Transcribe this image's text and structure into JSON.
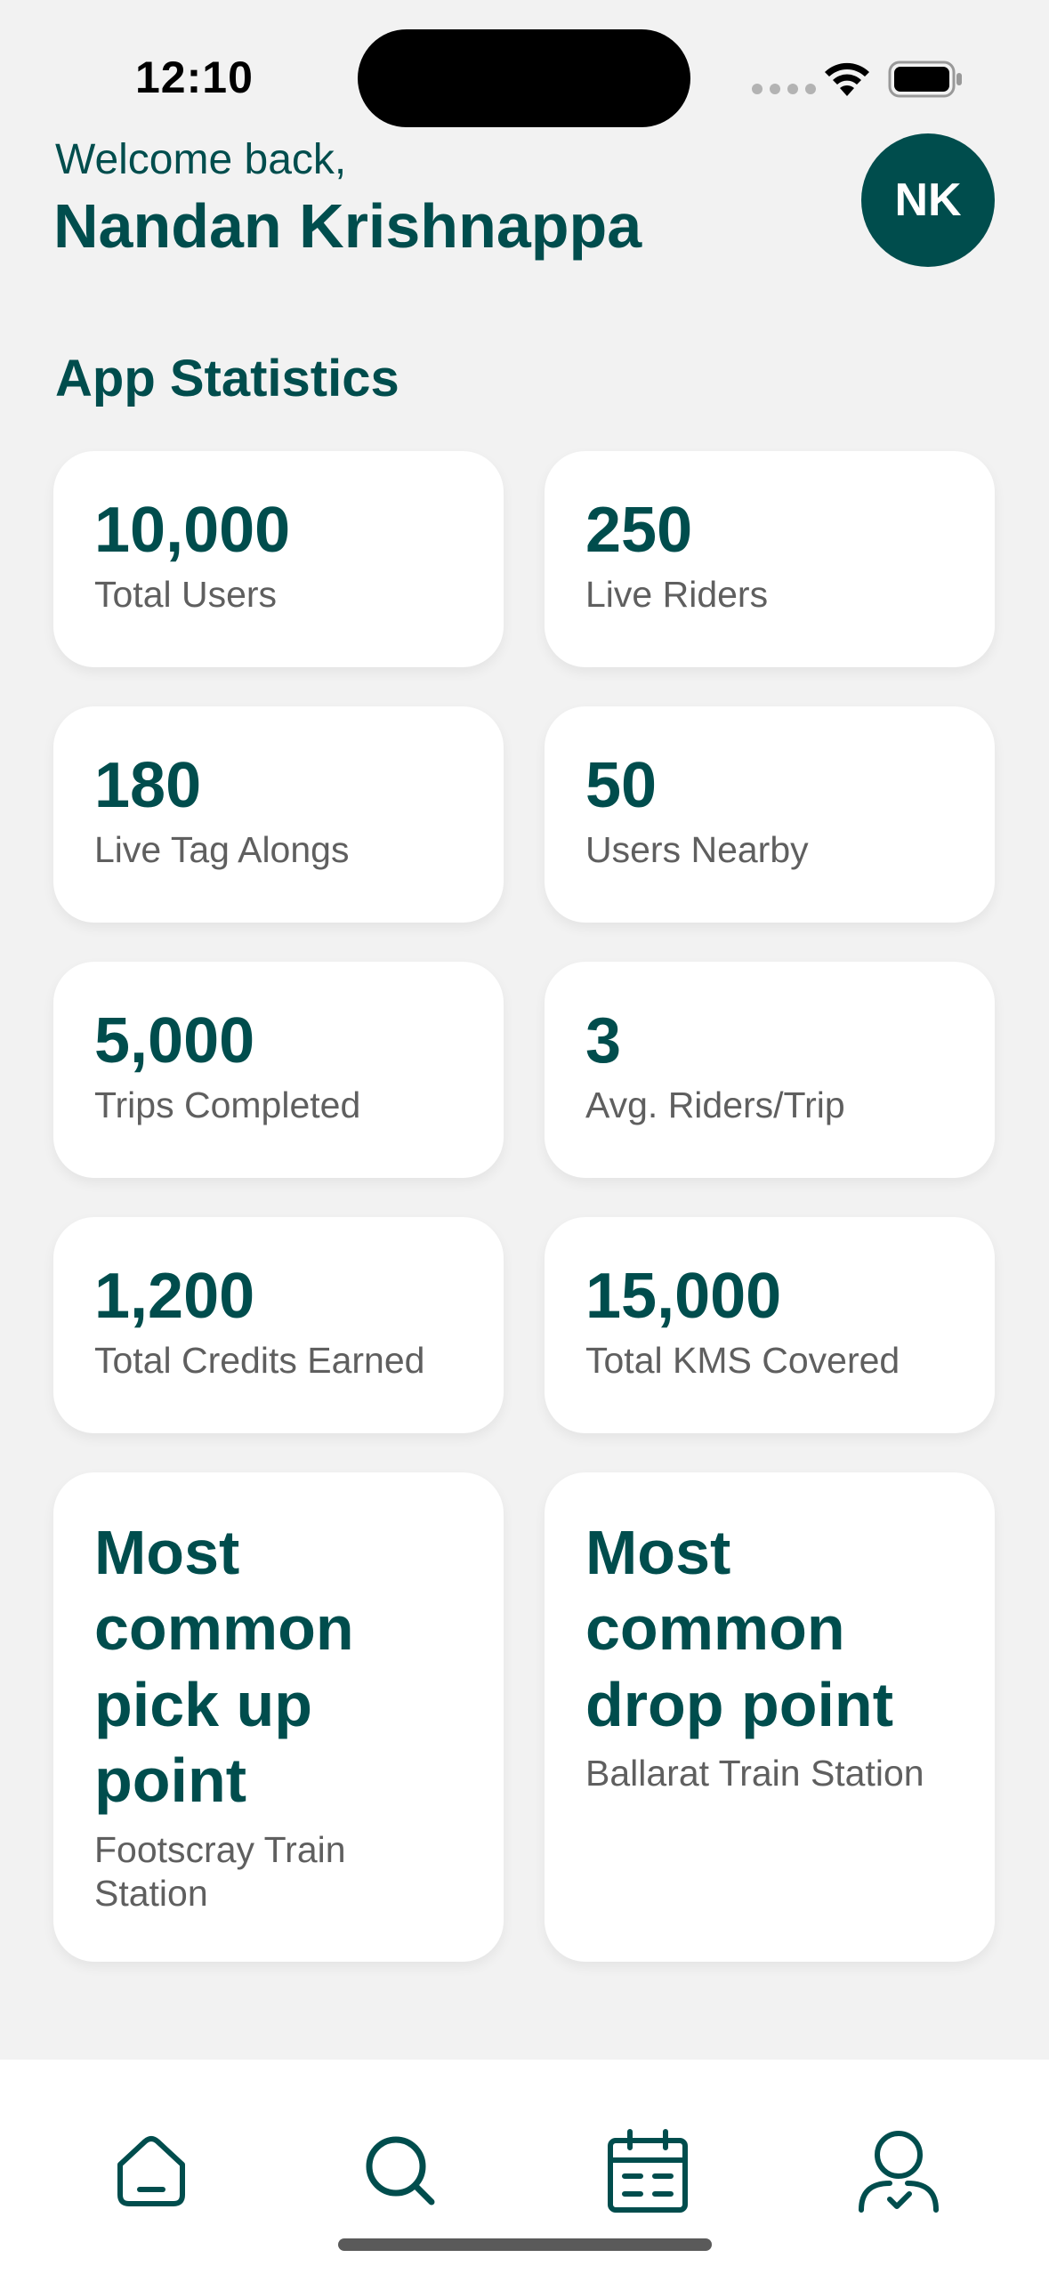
{
  "status_bar": {
    "time": "12:10"
  },
  "header": {
    "welcome": "Welcome back,",
    "user_name": "Nandan Krishnappa",
    "avatar_initials": "NK"
  },
  "section_title": "App Statistics",
  "stats": [
    {
      "value": "10,000",
      "label": "Total Users"
    },
    {
      "value": "250",
      "label": "Live Riders"
    },
    {
      "value": "180",
      "label": "Live Tag Alongs"
    },
    {
      "value": "50",
      "label": "Users Nearby"
    },
    {
      "value": "5,000",
      "label": "Trips Completed"
    },
    {
      "value": "3",
      "label": "Avg. Riders/Trip"
    },
    {
      "value": "1,200",
      "label": "Total Credits Earned"
    },
    {
      "value": "15,000",
      "label": "Total KMS Covered"
    },
    {
      "value": "Most common pick up point",
      "label": "Footscray Train Station"
    },
    {
      "value": "Most common drop point",
      "label": "Ballarat Train Station"
    }
  ],
  "tab_bar": {
    "tabs": [
      {
        "icon": "home-icon",
        "active": false
      },
      {
        "icon": "search-icon",
        "active": true
      },
      {
        "icon": "calendar-icon",
        "active": false
      },
      {
        "icon": "profile-icon",
        "active": false
      }
    ]
  },
  "colors": {
    "primary": "#004d4d",
    "background": "#f2f2f2",
    "card": "#ffffff",
    "label": "#5f5f5f"
  }
}
